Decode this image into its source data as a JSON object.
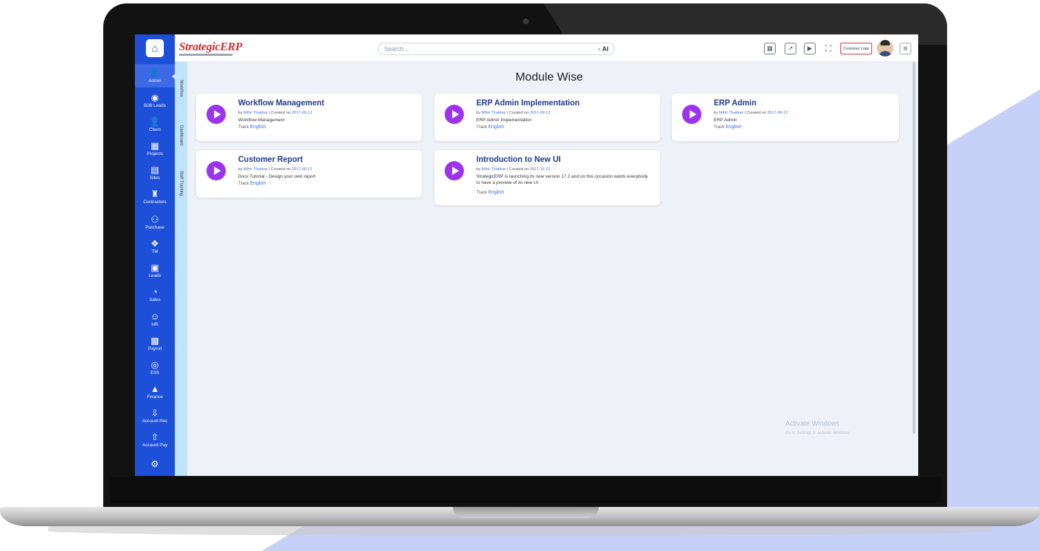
{
  "app": {
    "brand": "StrategicERP",
    "page_title": "Module Wise"
  },
  "topbar": {
    "search_placeholder": "Search...",
    "search_ai_label": "AI",
    "customer_logo_label": "Customer Logo",
    "icons": [
      "calculator-icon",
      "external-link-icon",
      "play-icon",
      "fullscreen-icon"
    ]
  },
  "sidebar": {
    "items": [
      {
        "label": "Admin",
        "icon": "👤",
        "active": true
      },
      {
        "label": "B2B Leads",
        "icon": "◉"
      },
      {
        "label": "Client",
        "icon": "👤"
      },
      {
        "label": "Projects",
        "icon": "▦"
      },
      {
        "label": "Sites",
        "icon": "▤"
      },
      {
        "label": "Contractors",
        "icon": "♜"
      },
      {
        "label": "Purchase",
        "icon": "⚇"
      },
      {
        "label": "TM",
        "icon": "❖"
      },
      {
        "label": "Leads",
        "icon": "▣"
      },
      {
        "label": "Sales",
        "icon": "◔"
      },
      {
        "label": "HR",
        "icon": "☺"
      },
      {
        "label": "Payroll",
        "icon": "▩"
      },
      {
        "label": "ESS",
        "icon": "◎"
      },
      {
        "label": "Finance",
        "icon": "▲"
      },
      {
        "label": "Account Rec",
        "icon": "⇩"
      },
      {
        "label": "Account Pay",
        "icon": "⇧"
      },
      {
        "label": "",
        "icon": "⚙"
      }
    ]
  },
  "vertical_tabs": [
    "Workflow",
    "Dashboard",
    "Staff Tracking"
  ],
  "cards": [
    {
      "title": "Workflow Management",
      "by_label": "by",
      "author": "Mihir Thakkar",
      "created_label": "| Created on",
      "date": "2017-09-13",
      "description": "Workflow Management",
      "track_label": "Track",
      "track": "English"
    },
    {
      "title": "ERP Admin Implementation",
      "by_label": "by",
      "author": "Mihir Thakkar",
      "created_label": "| Created on",
      "date": "2017-09-13",
      "description": "ERP Admin Implementation",
      "track_label": "Track",
      "track": "English"
    },
    {
      "title": "ERP Admin",
      "by_label": "by",
      "author": "Mihir Thakkar",
      "created_label": "| Created on",
      "date": "2017-09-13",
      "description": "ERP Admin",
      "track_label": "Track",
      "track": "English"
    },
    {
      "title": "Customer Report",
      "by_label": "by",
      "author": "Mihir Thakkar",
      "created_label": "| Created on",
      "date": "2017-09-13",
      "description": "Docx Tutorial - Design your own report",
      "track_label": "Track",
      "track": "English"
    },
    {
      "title": "Introduction to New UI",
      "by_label": "by",
      "author": "Mihir Thakkar",
      "created_label": "| Created on",
      "date": "2017-12-12",
      "description": "StrategicERP is launching its new version 17.2 and on this occasion wants everybody to have a preview of its new UI .",
      "track_label": "Track",
      "track": "English"
    }
  ],
  "watermark": {
    "title": "Activate Windows",
    "subtitle": "Go to Settings to activate Windows."
  },
  "colors": {
    "sidebar": "#1e4fd8",
    "accent_purple": "#9c33ee",
    "title_blue": "#1f3a8a",
    "background_shape": "#c7d0f7"
  }
}
